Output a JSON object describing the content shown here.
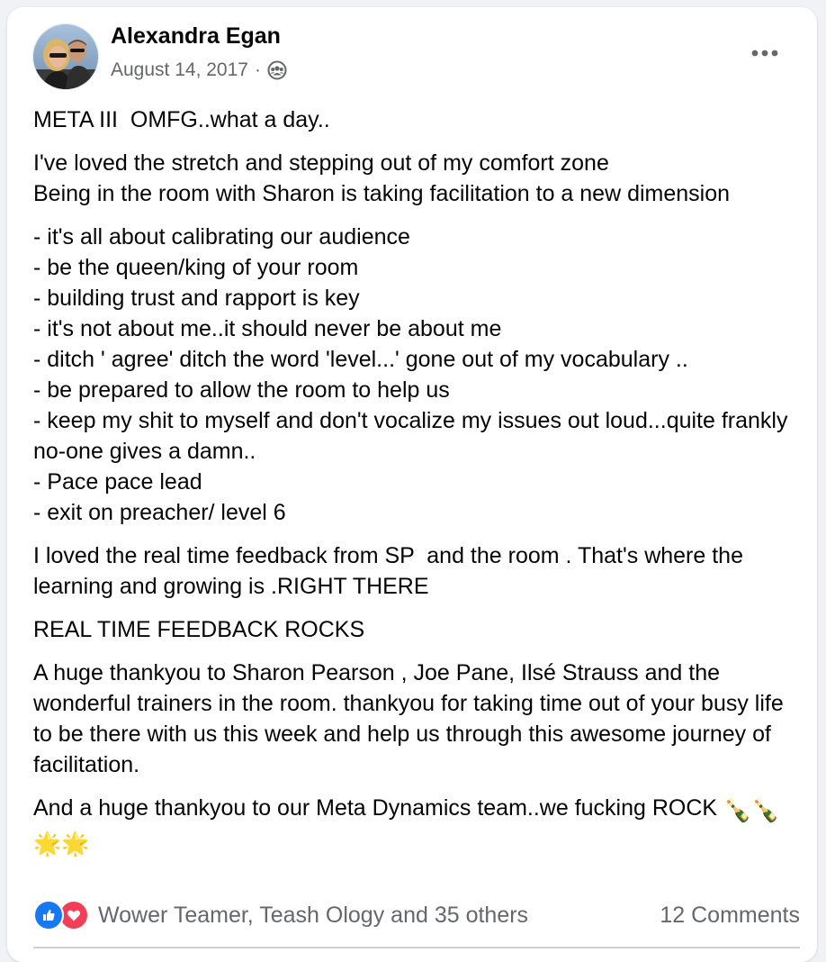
{
  "post": {
    "author": "Alexandra Egan",
    "date": "August 14, 2017",
    "separator": "·",
    "audience_icon": "friends-icon",
    "paragraphs": [
      "META III  OMFG..what a day..",
      "I've loved the stretch and stepping out of my comfort zone\nBeing in the room with Sharon is taking facilitation to a new dimension",
      "- it's all about calibrating our audience\n- be the queen/king of your room\n- building trust and rapport is key\n- it's not about me..it should never be about me\n- ditch ' agree' ditch the word 'level...' gone out of my vocabulary ..\n- be prepared to allow the room to help us\n- keep my shit to myself and don't vocalize my issues out loud...quite frankly no-one gives a damn..\n- Pace pace lead\n- exit on preacher/ level 6",
      "I loved the real time feedback from SP  and the room . That's where the learning and growing is .RIGHT THERE",
      "REAL TIME FEEDBACK ROCKS",
      "A huge thankyou to Sharon Pearson , Joe Pane, Ilsé Strauss and the wonderful trainers in the room. thankyou for taking time out of your busy life to be there with us this week and help us through this awesome journey of facilitation.",
      "And a huge thankyou to our Meta Dynamics team..we fucking ROCK"
    ],
    "closing_emojis": [
      "🍾",
      "🍾",
      "🌟",
      "🌟"
    ]
  },
  "footer": {
    "reactions": [
      "like-icon",
      "love-icon"
    ],
    "reaction_names": "Wower Teamer, Teash Ology and 35 others",
    "comments": "12 Comments"
  },
  "colors": {
    "like": "#1877f2",
    "love": "#f33e58",
    "secondary_text": "#65676b"
  }
}
